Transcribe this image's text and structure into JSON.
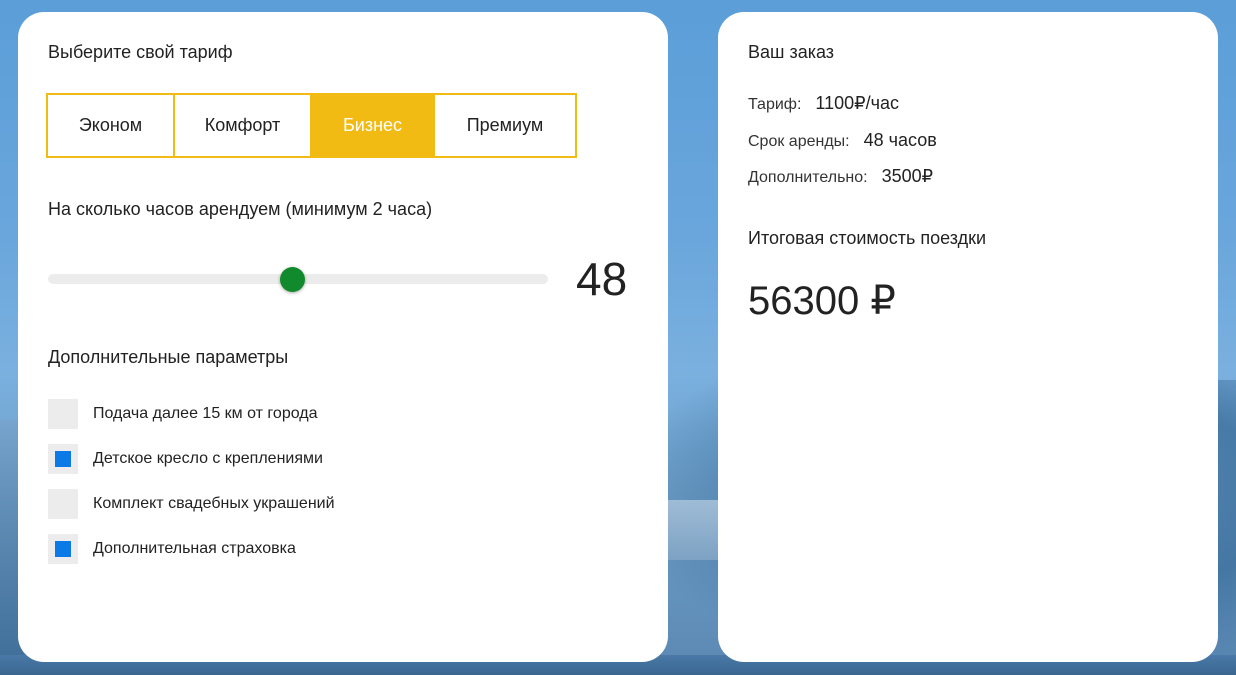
{
  "tariff_card": {
    "title": "Выберите свой тариф",
    "tabs": [
      {
        "label": "Эконом",
        "active": false
      },
      {
        "label": "Комфорт",
        "active": false
      },
      {
        "label": "Бизнес",
        "active": true
      },
      {
        "label": "Премиум",
        "active": false
      }
    ],
    "hours_label": "На сколько часов арендуем (минимум 2 часа)",
    "hours_value": "48",
    "hours_slider_fraction": 0.49,
    "options_title": "Дополнительные параметры",
    "options": [
      {
        "label": "Подача далее 15 км от города",
        "checked": false
      },
      {
        "label": "Детское кресло с креплениями",
        "checked": true
      },
      {
        "label": "Комплект свадебных украшений",
        "checked": false
      },
      {
        "label": "Дополнительная страховка",
        "checked": true
      }
    ]
  },
  "order_card": {
    "title": "Ваш заказ",
    "rows": [
      {
        "key": "Тариф:",
        "value": "1100₽/час"
      },
      {
        "key": "Срок аренды:",
        "value": "48 часов"
      },
      {
        "key": "Дополнительно:",
        "value": "3500₽"
      }
    ],
    "total_label": "Итоговая стоимость поездки",
    "total_value": "56300 ₽"
  },
  "colors": {
    "accent": "#f2bb13",
    "slider_thumb": "#118a2d",
    "checkbox_checked": "#0b7ae6",
    "background": "#5b9ed8"
  }
}
